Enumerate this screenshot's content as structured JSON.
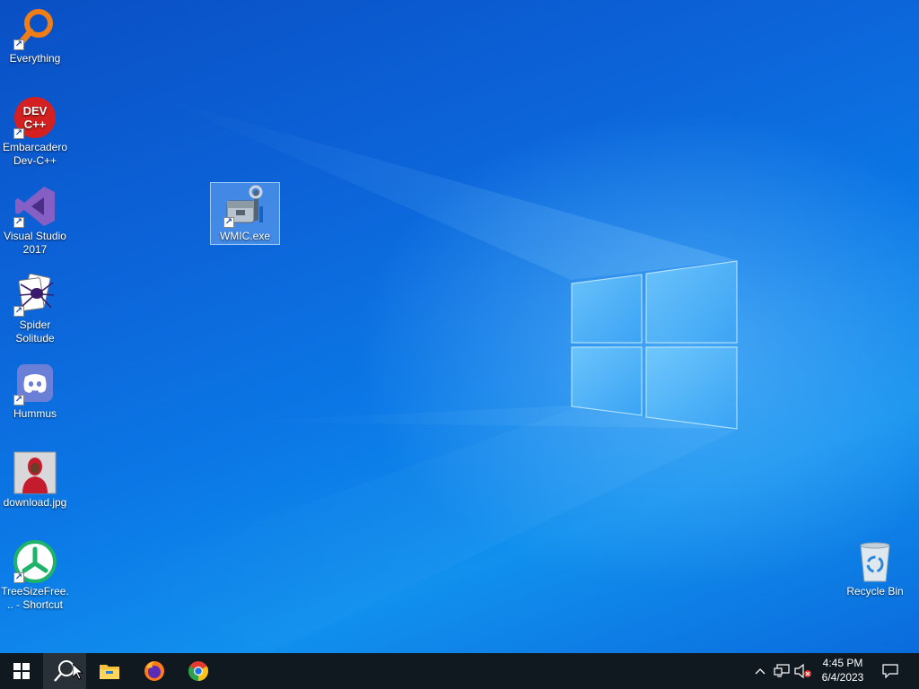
{
  "desktop": {
    "icons": [
      {
        "label": "Everything",
        "icon": "everything-icon"
      },
      {
        "label": "Embarcadero Dev-C++",
        "icon": "devcpp-icon",
        "badge": "DEV C++"
      },
      {
        "label": "Visual Studio 2017",
        "icon": "visual-studio-icon"
      },
      {
        "label": "Spider Solitude",
        "icon": "spider-solitaire-icon"
      },
      {
        "label": "Hummus",
        "icon": "discord-icon"
      },
      {
        "label": "download.jpg",
        "icon": "image-thumbnail"
      },
      {
        "label": "TreeSizeFree... - Shortcut",
        "icon": "treesize-icon"
      },
      {
        "label": "WMIC.exe",
        "icon": "wmic-icon"
      },
      {
        "label": "Recycle Bin",
        "icon": "recycle-bin-icon"
      }
    ]
  },
  "taskbar": {
    "start": "windows-start-icon",
    "search": "search-icon",
    "pinned": [
      "file-explorer-icon",
      "firefox-icon",
      "chrome-icon"
    ],
    "tray": {
      "chevron": "show-hidden-icons",
      "network": "network-icon",
      "volume": "volume-muted-icon",
      "time": "4:45 PM",
      "date": "6/4/2023",
      "notifications": "action-center-icon"
    }
  },
  "colors": {
    "taskbar": "#101820",
    "desktop_blue": "#0b6fe0"
  }
}
